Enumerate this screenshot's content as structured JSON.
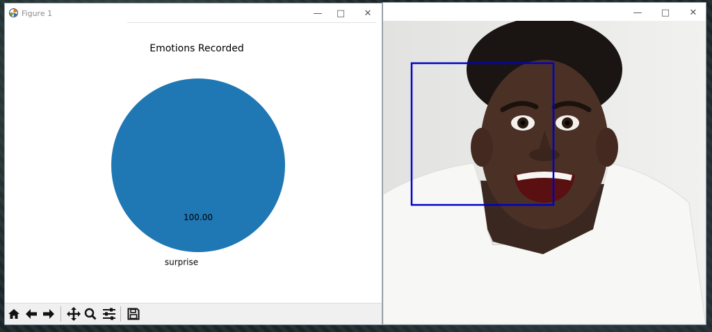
{
  "figure_window": {
    "title": "Figure 1",
    "controls": {
      "minimize": "—",
      "maximize": "□",
      "close": "✕"
    },
    "toolbar": [
      {
        "name": "home-icon"
      },
      {
        "name": "back-arrow-icon"
      },
      {
        "name": "forward-arrow-icon"
      },
      {
        "name": "pan-icon"
      },
      {
        "name": "zoom-icon"
      },
      {
        "name": "configure-subplots-icon"
      },
      {
        "name": "save-icon"
      }
    ]
  },
  "chart_data": {
    "type": "pie",
    "title": "Emotions Recorded",
    "labels": [
      "surprise"
    ],
    "values": [
      100.0
    ],
    "autopct": [
      "100.00"
    ],
    "colors": [
      "#1f77b4"
    ]
  },
  "image_window": {
    "title": "",
    "controls": {
      "minimize": "—",
      "maximize": "□",
      "close": "✕"
    },
    "box_color": "#0000c8"
  }
}
